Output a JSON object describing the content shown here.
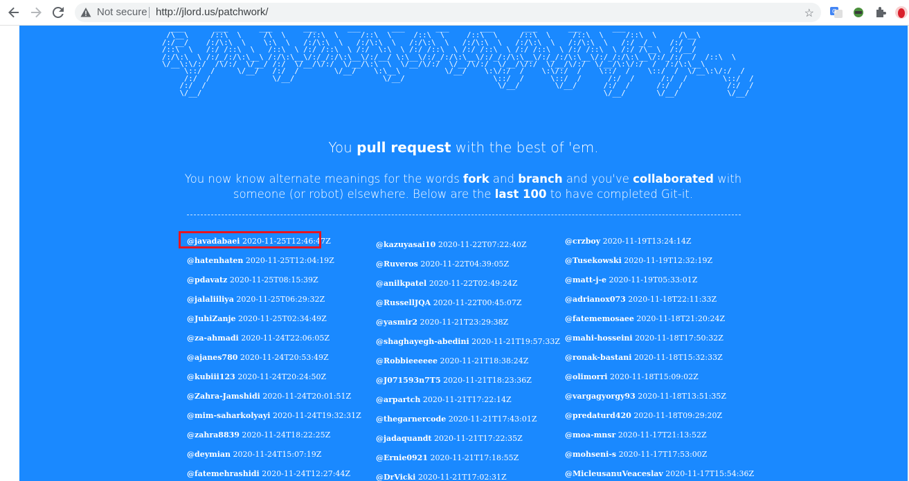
{
  "browser": {
    "security_label": "Not secure",
    "url": "http://jlord.us/patchwork/"
  },
  "page": {
    "ascii_art": "  ___       ___       ___       ___       ___       ___       ___       ___       ___       ___       ___\n /\\__\\     /::\\  \\     /\\  \\     /::\\  \\     /::\\  \\     /::\\  \\     /::\\  \\     /::\\  \\     /::\\  \\     /::\\  \\     /\\__\\\n/:/__/    /:/\\:\\  \\    \\:\\  \\   /:/\\:\\  \\   /:/\\:\\  \\   /:/\\:\\  \\   /:/\\:\\  \\   /:/\\:\\  \\   /:/\\:\\  \\   /:/ _/_    /:/  /\n/::\\  \\   /:/ /::\\  \\   /::\\  \\ /:/ /::\\  \\ /:/  \\:\\  \\ /:/ /::\\  \\ /:/ /::\\  \\ /:/ /::\\  \\ /:/ /::\\  \\ /:/ /\\__\\  /:/__/\n/:/\\:\\  \\ /:/_/:/\\:\\__\\ /:/\\:\\__\\/:/_/:/\\:\\__\\/:/__/ \\:\\__\\/:/_/:/\\:\\__\\/:/_/:/\\:\\__\\/:/_/:/\\:\\__\\/:/_/:/\\:\\__\\/:/_/:/  /  /::\\  \\\n\\/__\\:\\/:/  /\\/:/  \\/__/ /:/  \\/__/\\/:/  \\/__/\\:\\  \\  \\/__/\\/:/  \\/__/\\/:/  \\/__/\\/:/  \\/__/\\/:/  \\/__/\\:\\/:/  /  /:/\\:\\__\\\n     \\::/  /     \\/__/   /:/  /        \\/__/    \\:\\__\\          \\/__/    \\:\\/:/  /    \\:\\/:/  /    \\::/  /    \\::/  /  \\/__\\:\\/:/  /\n     /:/  /              \\/__/                    \\/__/                    \\::/  /      \\::/  /      /:/  /      /:/  /        \\::/  /\n    /:/  /                                                                  \\/__/        \\/__/      /:/  /      /:/  /          /:/  /\n    \\/__/                                                                                           \\/__/       \\/__/           \\/__/",
    "tagline": {
      "pre": "You ",
      "bold": "pull request",
      "post": " with the best of 'em."
    },
    "description": {
      "p1": "You now know alternate meanings for the words ",
      "b1": "fork",
      "p2": " and ",
      "b2": "branch",
      "p3": " and you've ",
      "b3": "collaborated",
      "p4": " with someone (or robot) elsewhere. Below are the ",
      "b4": "last 100",
      "p5": " to have completed Git-it."
    },
    "columns": [
      [
        {
          "user": "@javadabaei",
          "date": "2020-11-25T12:46:47Z"
        },
        {
          "user": "@hatenhaten",
          "date": "2020-11-25T12:04:19Z"
        },
        {
          "user": "@pdavatz",
          "date": "2020-11-25T08:15:39Z"
        },
        {
          "user": "@jalaliiliya",
          "date": "2020-11-25T06:29:32Z"
        },
        {
          "user": "@JuhiZanje",
          "date": "2020-11-25T02:34:49Z"
        },
        {
          "user": "@za-ahmadi",
          "date": "2020-11-24T22:06:05Z"
        },
        {
          "user": "@ajanes780",
          "date": "2020-11-24T20:53:49Z"
        },
        {
          "user": "@kubiii123",
          "date": "2020-11-24T20:24:50Z"
        },
        {
          "user": "@Zahra-Jamshidi",
          "date": "2020-11-24T20:01:51Z"
        },
        {
          "user": "@mim-saharkolyayi",
          "date": "2020-11-24T19:32:31Z"
        },
        {
          "user": "@zahra8839",
          "date": "2020-11-24T18:22:25Z"
        },
        {
          "user": "@deymian",
          "date": "2020-11-24T15:07:19Z"
        },
        {
          "user": "@fatemehrashidi",
          "date": "2020-11-24T12:27:44Z"
        }
      ],
      [
        {
          "user": "@kazuyasai10",
          "date": "2020-11-22T07:22:40Z"
        },
        {
          "user": "@Ruveros",
          "date": "2020-11-22T04:39:05Z"
        },
        {
          "user": "@anilkpatel",
          "date": "2020-11-22T02:49:24Z"
        },
        {
          "user": "@RussellJQA",
          "date": "2020-11-22T00:45:07Z"
        },
        {
          "user": "@yasmir2",
          "date": "2020-11-21T23:29:38Z"
        },
        {
          "user": "@shaghayegh-abedini",
          "date": "2020-11-21T19:57:33Z"
        },
        {
          "user": "@Robbieeeeee",
          "date": "2020-11-21T18:38:24Z"
        },
        {
          "user": "@J071593n7T5",
          "date": "2020-11-21T18:23:36Z"
        },
        {
          "user": "@arpartch",
          "date": "2020-11-21T17:22:14Z"
        },
        {
          "user": "@thegarnercode",
          "date": "2020-11-21T17:43:01Z"
        },
        {
          "user": "@jadaquandt",
          "date": "2020-11-21T17:22:35Z"
        },
        {
          "user": "@Ernie0921",
          "date": "2020-11-21T17:18:55Z"
        },
        {
          "user": "@DrVicki",
          "date": "2020-11-21T17:02:31Z"
        }
      ],
      [
        {
          "user": "@crzboy",
          "date": "2020-11-19T13:24:14Z"
        },
        {
          "user": "@Tusekowski",
          "date": "2020-11-19T12:32:19Z"
        },
        {
          "user": "@matt-j-e",
          "date": "2020-11-19T05:33:01Z"
        },
        {
          "user": "@adrianox073",
          "date": "2020-11-18T22:11:33Z"
        },
        {
          "user": "@fatememosaee",
          "date": "2020-11-18T21:20:24Z"
        },
        {
          "user": "@mahi-hosseini",
          "date": "2020-11-18T17:50:32Z"
        },
        {
          "user": "@ronak-bastani",
          "date": "2020-11-18T15:32:33Z"
        },
        {
          "user": "@olimorri",
          "date": "2020-11-18T15:09:02Z"
        },
        {
          "user": "@vargagyorgy93",
          "date": "2020-11-18T13:51:35Z"
        },
        {
          "user": "@predaturd420",
          "date": "2020-11-18T09:29:20Z"
        },
        {
          "user": "@moa-mnsr",
          "date": "2020-11-17T21:13:52Z"
        },
        {
          "user": "@mohseni-s",
          "date": "2020-11-17T17:53:00Z"
        },
        {
          "user": "@MicleusanuVeaceslav",
          "date": "2020-11-17T15:54:36Z"
        }
      ]
    ]
  },
  "colors": {
    "page_background": "#1a89ff",
    "text": "#ffffff",
    "highlight_border": "#e8141e"
  },
  "icons": [
    "back-arrow-icon",
    "forward-arrow-icon",
    "reload-icon",
    "warning-icon",
    "star-icon",
    "translate-icon",
    "globe-extension-icon",
    "puzzle-icon",
    "profile-avatar-icon"
  ]
}
